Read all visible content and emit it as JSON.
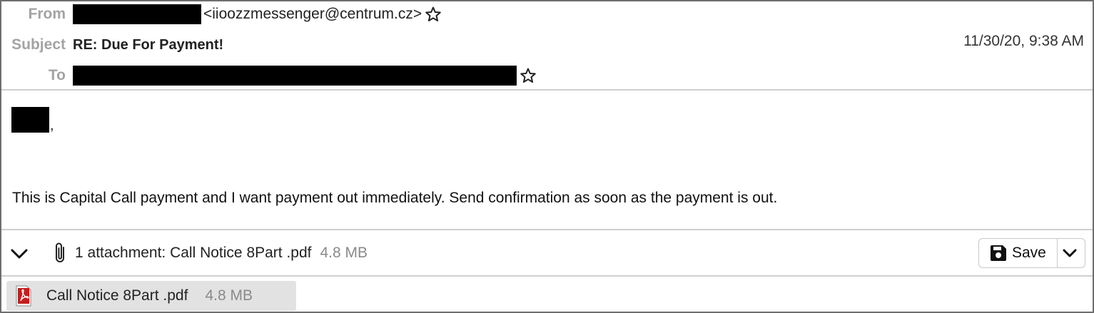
{
  "header": {
    "from_label": "From",
    "from_address": "<iioozzmessenger@centrum.cz>",
    "subject_label": "Subject",
    "subject": "RE: Due For Payment!",
    "date": "11/30/20, 9:38 AM",
    "to_label": "To"
  },
  "body": {
    "greeting_suffix": ",",
    "message": "This is Capital Call payment and I want payment out immediately. Send confirmation as soon as the payment is out."
  },
  "attachments_bar": {
    "summary": "1 attachment: Call Notice 8Part .pdf",
    "size": "4.8 MB",
    "save_label": "Save"
  },
  "attachment_item": {
    "name": "Call Notice 8Part .pdf",
    "size": "4.8 MB",
    "icon": "pdf-file-icon"
  }
}
